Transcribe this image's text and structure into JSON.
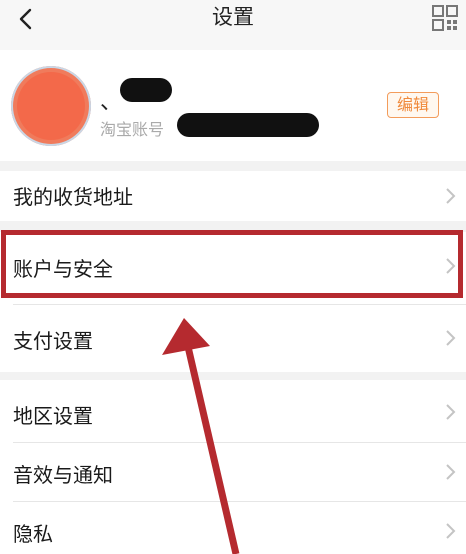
{
  "header": {
    "title": "设置",
    "back_icon": "chevron-left-icon",
    "right_icon": "qr-code-icon"
  },
  "profile": {
    "nickname_prefix": "、",
    "account_label": "淘宝账号",
    "edit_label": "编辑",
    "avatar_color": "#f3694a"
  },
  "menu": {
    "items": [
      {
        "label": "我的收货地址"
      },
      {
        "label": "账户与安全"
      },
      {
        "label": "支付设置"
      },
      {
        "label": "地区设置"
      },
      {
        "label": "音效与通知"
      },
      {
        "label": "隐私"
      }
    ]
  },
  "annotation": {
    "highlight_color": "#b52a2f",
    "highlighted_item": "账户与安全"
  }
}
